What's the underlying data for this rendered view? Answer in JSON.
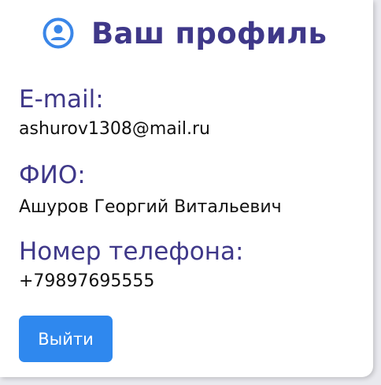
{
  "colors": {
    "accent": "#3f3889",
    "icon": "#3a86e8",
    "button_bg": "#2f88ee",
    "text": "#111111",
    "card_bg": "#ffffff"
  },
  "header": {
    "icon": "user-circle-icon",
    "title": "Ваш профиль"
  },
  "profile": {
    "email_label": "E-mail:",
    "email_value": "ashurov1308@mail.ru",
    "fio_label": "ФИО:",
    "fio_value": "Ашуров Георгий Витальевич",
    "phone_label": "Номер телефона:",
    "phone_value": "+79897695555"
  },
  "actions": {
    "logout_label": "Выйти"
  }
}
